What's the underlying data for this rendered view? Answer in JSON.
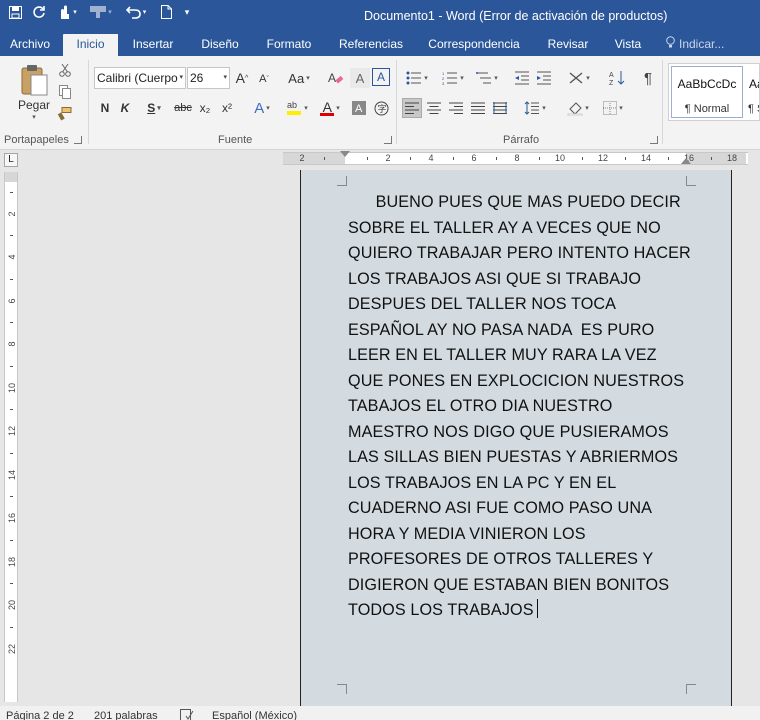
{
  "titlebar": {
    "title": "Documento1 - Word (Error de activación de productos)"
  },
  "tabs": [
    {
      "label": "Archivo",
      "active": false
    },
    {
      "label": "Inicio",
      "active": true
    },
    {
      "label": "Insertar",
      "active": false
    },
    {
      "label": "Diseño",
      "active": false
    },
    {
      "label": "Formato",
      "active": false
    },
    {
      "label": "Referencias",
      "active": false
    },
    {
      "label": "Correspondencia",
      "active": false
    },
    {
      "label": "Revisar",
      "active": false
    },
    {
      "label": "Vista",
      "active": false
    }
  ],
  "tell_me": {
    "placeholder": "Indicar..."
  },
  "ribbon": {
    "clipboard": {
      "paste_label": "Pegar",
      "group_label": "Portapapeles"
    },
    "font": {
      "font_name": "Calibri (Cuerpo",
      "font_size": "26",
      "group_label": "Fuente",
      "bold": "N",
      "italic": "K",
      "underline": "S",
      "strike": "abc",
      "subscript": "x₂",
      "superscript": "x²",
      "change_case": "Aa",
      "grow": "A",
      "shrink": "A",
      "font_color_letter": "A",
      "text_effect_letter": "A",
      "char_border_letter": "A",
      "char_shading_letter": "A"
    },
    "paragraph": {
      "group_label": "Párrafo"
    },
    "styles": [
      {
        "sample": "AaBbCcDc",
        "name": "¶ Normal"
      },
      {
        "sample": "Aa",
        "name": "¶ S"
      }
    ],
    "accent_color": "#2b579a"
  },
  "ruler": {
    "h_labels": [
      "2",
      "2",
      "4",
      "6",
      "8",
      "10",
      "12",
      "14",
      "16",
      "18"
    ],
    "v_labels": [
      "2",
      "4",
      "6",
      "8",
      "10",
      "12",
      "14",
      "16",
      "18",
      "20",
      "22"
    ],
    "tab_selector": "L"
  },
  "document": {
    "lines": [
      "      BUENO PUES QUE MAS PUEDO DECIR",
      "SOBRE EL TALLER AY A VECES QUE NO",
      "QUIERO TRABAJAR PERO INTENTO HACER",
      "LOS TRABAJOS ASI QUE SI TRABAJO",
      "DESPUES DEL TALLER NOS TOCA",
      "ESPAÑOL AY NO PASA NADA  ES PURO",
      "LEER EN EL TALLER MUY RARA LA VEZ",
      "QUE PONES EN EXPLOCICION NUESTROS",
      "TABAJOS EL OTRO DIA NUESTRO",
      "MAESTRO NOS DIGO QUE PUSIERAMOS",
      "LAS SILLAS BIEN PUESTAS Y ABRIERMOS",
      "LOS TRABAJOS EN LA PC Y EN EL",
      "CUADERNO ASI FUE COMO PASO UNA",
      "HORA Y MEDIA VINIERON LOS",
      "PROFESORES DE OTROS TALLERES Y",
      "DIGIERON QUE ESTABAN BIEN BONITOS",
      "TODOS LOS TRABAJOS"
    ],
    "page_color": "#d3dbe1"
  },
  "status": {
    "page": "Página 2 de 2",
    "words": "201 palabras",
    "language": "Español (México)"
  }
}
